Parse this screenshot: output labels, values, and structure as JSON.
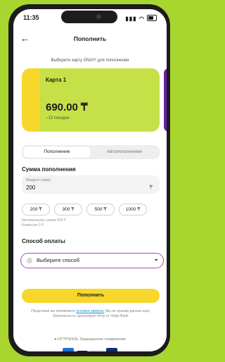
{
  "status": {
    "time": "11:35"
  },
  "header": {
    "title": "Пополнить"
  },
  "subtitle": "Выберите карту ONAY! для пополнения",
  "card": {
    "name": "Карта 1",
    "amount": "690.00 ₸",
    "trips": "~13 поездок"
  },
  "tabs": [
    {
      "label": "Пополнение"
    },
    {
      "label": "Автопополнение"
    }
  ],
  "amount": {
    "heading": "Сумма пополнения",
    "field_label": "Введите сумму",
    "value": "200",
    "currency": "₸",
    "chips": [
      "200 ₸",
      "300 ₸",
      "500 ₸",
      "1000 ₸"
    ],
    "min_sum": "Минимальная сумма 200 ₸",
    "commission": "Комиссия 0 ₸"
  },
  "payment": {
    "heading": "Способ оплаты",
    "placeholder": "Выберите способ"
  },
  "button": {
    "label": "Пополнить"
  },
  "note": {
    "before": "Продолжая вы принимаете",
    "link": "условия оферты.",
    "after": "Мы не храним данных карт. Безопасность гарантирует ePay от Halyk Bank"
  },
  "ssl": "HTTPS/SSL Защищенное соединение",
  "colors": {
    "background": "#a9d62e",
    "card": "#c6e048",
    "accent": "#f7d72c",
    "select_border": "#a04bc8"
  },
  "icons": {
    "back": "arrow-left-icon",
    "chevron": "chevron-down-icon"
  }
}
